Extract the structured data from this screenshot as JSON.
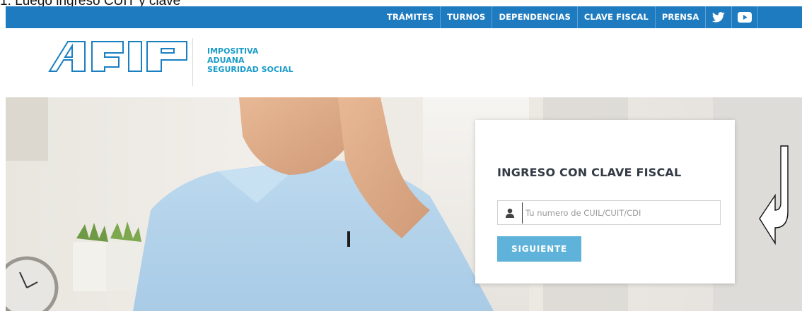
{
  "caption": "Luego ingreso CUIT y clave",
  "topnav": {
    "items": [
      "TRÁMITES",
      "TURNOS",
      "DEPENDENCIAS",
      "CLAVE FISCAL",
      "PRENSA"
    ],
    "icons": [
      "twitter-icon",
      "youtube-icon"
    ]
  },
  "brand": {
    "logo_text": "AFIP",
    "tagline": [
      "IMPOSITIVA",
      "ADUANA",
      "SEGURIDAD SOCIAL"
    ]
  },
  "login": {
    "title": "INGRESO CON CLAVE FISCAL",
    "input_placeholder": "Tu numero de CUIL/CUIT/CDI",
    "input_value": "",
    "button_label": "SIGUIENTE",
    "user_icon": "user-icon"
  },
  "colors": {
    "topbar": "#1f7bc0",
    "tagline": "#1a9cc9",
    "button": "#5fb3da",
    "title": "#333b44"
  }
}
